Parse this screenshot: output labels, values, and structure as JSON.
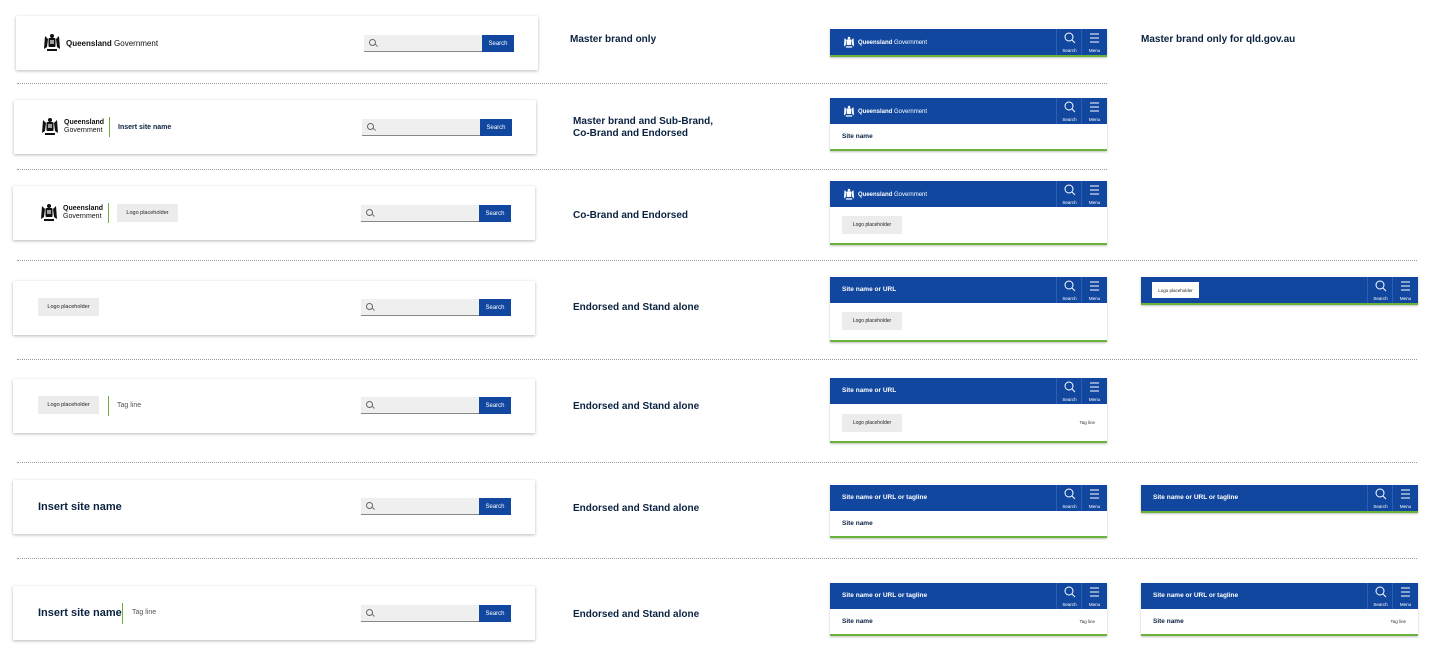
{
  "brand": {
    "logo_bold": "Queensland",
    "logo_regular": "Government",
    "crest_icon": "queensland-crest-icon"
  },
  "colors": {
    "primary": "#11479e",
    "accent": "#6ab23a",
    "text": "#0a2240"
  },
  "search": {
    "button_label": "Search"
  },
  "mobile_icons": {
    "search_label": "Search",
    "menu_label": "Menu"
  },
  "rows": [
    {
      "description": "Master brand only",
      "right_description": "Master brand only for qld.gov.au"
    },
    {
      "description_line1": "Master brand and Sub-Brand,",
      "description_line2": "Co-Brand and Endorsed",
      "site_name": "Insert site name",
      "mobile_site": "Site name"
    },
    {
      "description": "Co-Brand and Endorsed",
      "logo_placeholder": "Logo placeholder",
      "mobile_logo_placeholder": "Logo placeholder"
    },
    {
      "description": "Endorsed and Stand alone",
      "logo_placeholder": "Logo placeholder",
      "mobile_title": "Site name or URL",
      "mobile_logo_placeholder": "Logo placeholder",
      "alt_logo_placeholder": "Logo placeholder"
    },
    {
      "description": "Endorsed and Stand alone",
      "logo_placeholder": "Logo placeholder",
      "tagline": "Tag line",
      "mobile_title": "Site name or URL",
      "mobile_logo_placeholder": "Logo placeholder",
      "mobile_tagline": "Tag line"
    },
    {
      "description": "Endorsed and Stand alone",
      "site_name": "Insert site name",
      "mobile_title": "Site name or URL or tagline",
      "mobile_site": "Site name",
      "alt_title": "Site name or URL or tagline"
    },
    {
      "description": "Endorsed and Stand alone",
      "site_name": "Insert site name",
      "tagline": "Tag line",
      "mobile_title": "Site name or URL or tagline",
      "mobile_site": "Site name",
      "mobile_tagline": "Tag line",
      "alt_title": "Site name or URL or tagline",
      "alt_site": "Site name",
      "alt_tagline": "Tag line"
    }
  ]
}
